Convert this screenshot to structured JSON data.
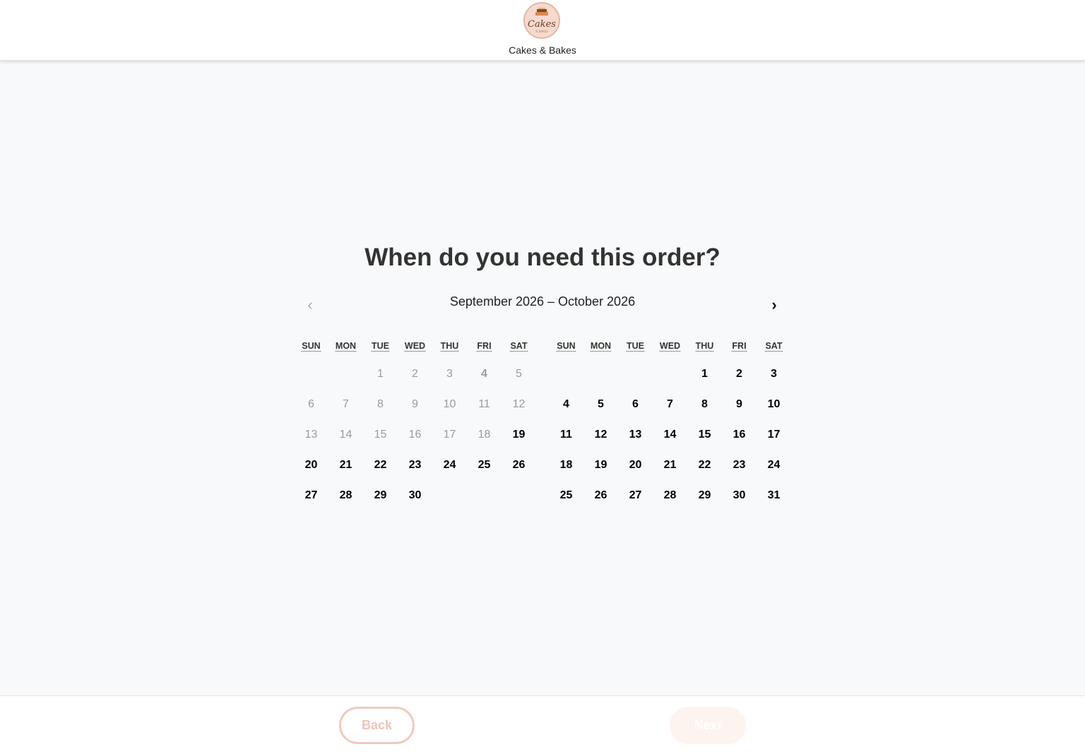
{
  "brand": {
    "name": "Cakes & Bakes",
    "logo_icon": "cake-logo-icon",
    "logo_text": "Cakes",
    "logo_subtext": "& BAKES"
  },
  "page": {
    "title": "When do you need this order?"
  },
  "calendar": {
    "range_label": "September 2026 – October 2026",
    "prev_icon": "chevron-left-icon",
    "next_icon": "chevron-right-icon",
    "prev_glyph": "‹",
    "next_glyph": "›",
    "months": [
      {
        "name": "September 2026",
        "weekdays": [
          "SUN",
          "MON",
          "TUE",
          "WED",
          "THU",
          "FRI",
          "SAT"
        ],
        "weeks": [
          [
            {
              "d": ""
            },
            {
              "d": ""
            },
            {
              "d": "1",
              "s": "dis"
            },
            {
              "d": "2",
              "s": "dis"
            },
            {
              "d": "3",
              "s": "dis"
            },
            {
              "d": "4",
              "s": "disb"
            },
            {
              "d": "5",
              "s": "dis"
            }
          ],
          [
            {
              "d": "6",
              "s": "dis"
            },
            {
              "d": "7",
              "s": "dis"
            },
            {
              "d": "8",
              "s": "dis"
            },
            {
              "d": "9",
              "s": "dis"
            },
            {
              "d": "10",
              "s": "dis"
            },
            {
              "d": "11",
              "s": "dis"
            },
            {
              "d": "12",
              "s": "dis"
            }
          ],
          [
            {
              "d": "13",
              "s": "dis"
            },
            {
              "d": "14",
              "s": "dis"
            },
            {
              "d": "15",
              "s": "dis"
            },
            {
              "d": "16",
              "s": "dis"
            },
            {
              "d": "17",
              "s": "dis"
            },
            {
              "d": "18",
              "s": "dis"
            },
            {
              "d": "19",
              "s": "avail"
            }
          ],
          [
            {
              "d": "20",
              "s": "avail"
            },
            {
              "d": "21",
              "s": "avail"
            },
            {
              "d": "22",
              "s": "avail"
            },
            {
              "d": "23",
              "s": "avail"
            },
            {
              "d": "24",
              "s": "avail"
            },
            {
              "d": "25",
              "s": "avail"
            },
            {
              "d": "26",
              "s": "avail"
            }
          ],
          [
            {
              "d": "27",
              "s": "avail"
            },
            {
              "d": "28",
              "s": "avail"
            },
            {
              "d": "29",
              "s": "avail"
            },
            {
              "d": "30",
              "s": "avail"
            },
            {
              "d": ""
            },
            {
              "d": ""
            },
            {
              "d": ""
            }
          ]
        ]
      },
      {
        "name": "October 2026",
        "weekdays": [
          "SUN",
          "MON",
          "TUE",
          "WED",
          "THU",
          "FRI",
          "SAT"
        ],
        "weeks": [
          [
            {
              "d": ""
            },
            {
              "d": ""
            },
            {
              "d": ""
            },
            {
              "d": ""
            },
            {
              "d": "1",
              "s": "avail"
            },
            {
              "d": "2",
              "s": "avail"
            },
            {
              "d": "3",
              "s": "avail"
            }
          ],
          [
            {
              "d": "4",
              "s": "avail"
            },
            {
              "d": "5",
              "s": "avail"
            },
            {
              "d": "6",
              "s": "avail"
            },
            {
              "d": "7",
              "s": "avail"
            },
            {
              "d": "8",
              "s": "avail"
            },
            {
              "d": "9",
              "s": "avail"
            },
            {
              "d": "10",
              "s": "avail"
            }
          ],
          [
            {
              "d": "11",
              "s": "avail"
            },
            {
              "d": "12",
              "s": "avail"
            },
            {
              "d": "13",
              "s": "avail"
            },
            {
              "d": "14",
              "s": "avail"
            },
            {
              "d": "15",
              "s": "avail"
            },
            {
              "d": "16",
              "s": "avail"
            },
            {
              "d": "17",
              "s": "avail"
            }
          ],
          [
            {
              "d": "18",
              "s": "avail"
            },
            {
              "d": "19",
              "s": "avail"
            },
            {
              "d": "20",
              "s": "avail"
            },
            {
              "d": "21",
              "s": "avail"
            },
            {
              "d": "22",
              "s": "avail"
            },
            {
              "d": "23",
              "s": "avail"
            },
            {
              "d": "24",
              "s": "avail"
            }
          ],
          [
            {
              "d": "25",
              "s": "avail"
            },
            {
              "d": "26",
              "s": "avail"
            },
            {
              "d": "27",
              "s": "avail"
            },
            {
              "d": "28",
              "s": "avail"
            },
            {
              "d": "29",
              "s": "avail"
            },
            {
              "d": "30",
              "s": "avail"
            },
            {
              "d": "31",
              "s": "avail"
            }
          ]
        ]
      }
    ]
  },
  "footer": {
    "back_label": "Back",
    "next_label": "Next"
  },
  "colors": {
    "accent": "#f0c9c0",
    "next_bg": "#fdf3ef",
    "available": "#000000",
    "disabled": "#9b9b9b"
  }
}
